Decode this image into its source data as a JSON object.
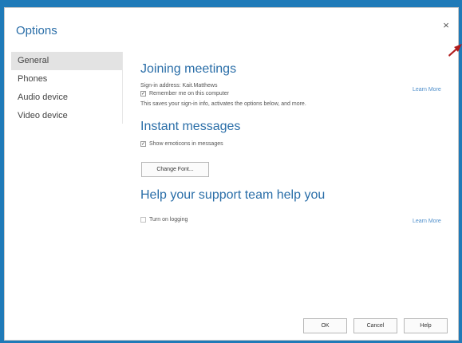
{
  "dialog": {
    "title": "Options",
    "close_glyph": "×"
  },
  "nav": {
    "items": [
      {
        "label": "General",
        "active": true
      },
      {
        "label": "Phones",
        "active": false
      },
      {
        "label": "Audio device",
        "active": false
      },
      {
        "label": "Video device",
        "active": false
      }
    ]
  },
  "sections": {
    "joining": {
      "heading": "Joining meetings",
      "signin": "Sign-in address: Kait.Matthews",
      "remember_label": "Remember me on this computer",
      "remember_checked": true,
      "description": "This saves your sign-in info, activates the options below, and more.",
      "learn_more": "Learn More"
    },
    "im": {
      "heading": "Instant messages",
      "emoticons_label": "Show emoticons in messages",
      "emoticons_checked": true,
      "change_font": "Change Font..."
    },
    "support": {
      "heading": "Help your support team help you",
      "logging_label": "Turn on logging",
      "logging_checked": false,
      "learn_more": "Learn More"
    }
  },
  "footer": {
    "ok": "OK",
    "cancel": "Cancel",
    "help": "Help"
  },
  "colors": {
    "accent": "#2a6ea8",
    "link": "#4f8fcb",
    "frame": "#1f7ab8",
    "annotation_arrow": "#b01c1c"
  },
  "icons": {
    "close": "close-icon",
    "arrow": "annotation-arrow-icon",
    "check": "checkmark-icon"
  }
}
